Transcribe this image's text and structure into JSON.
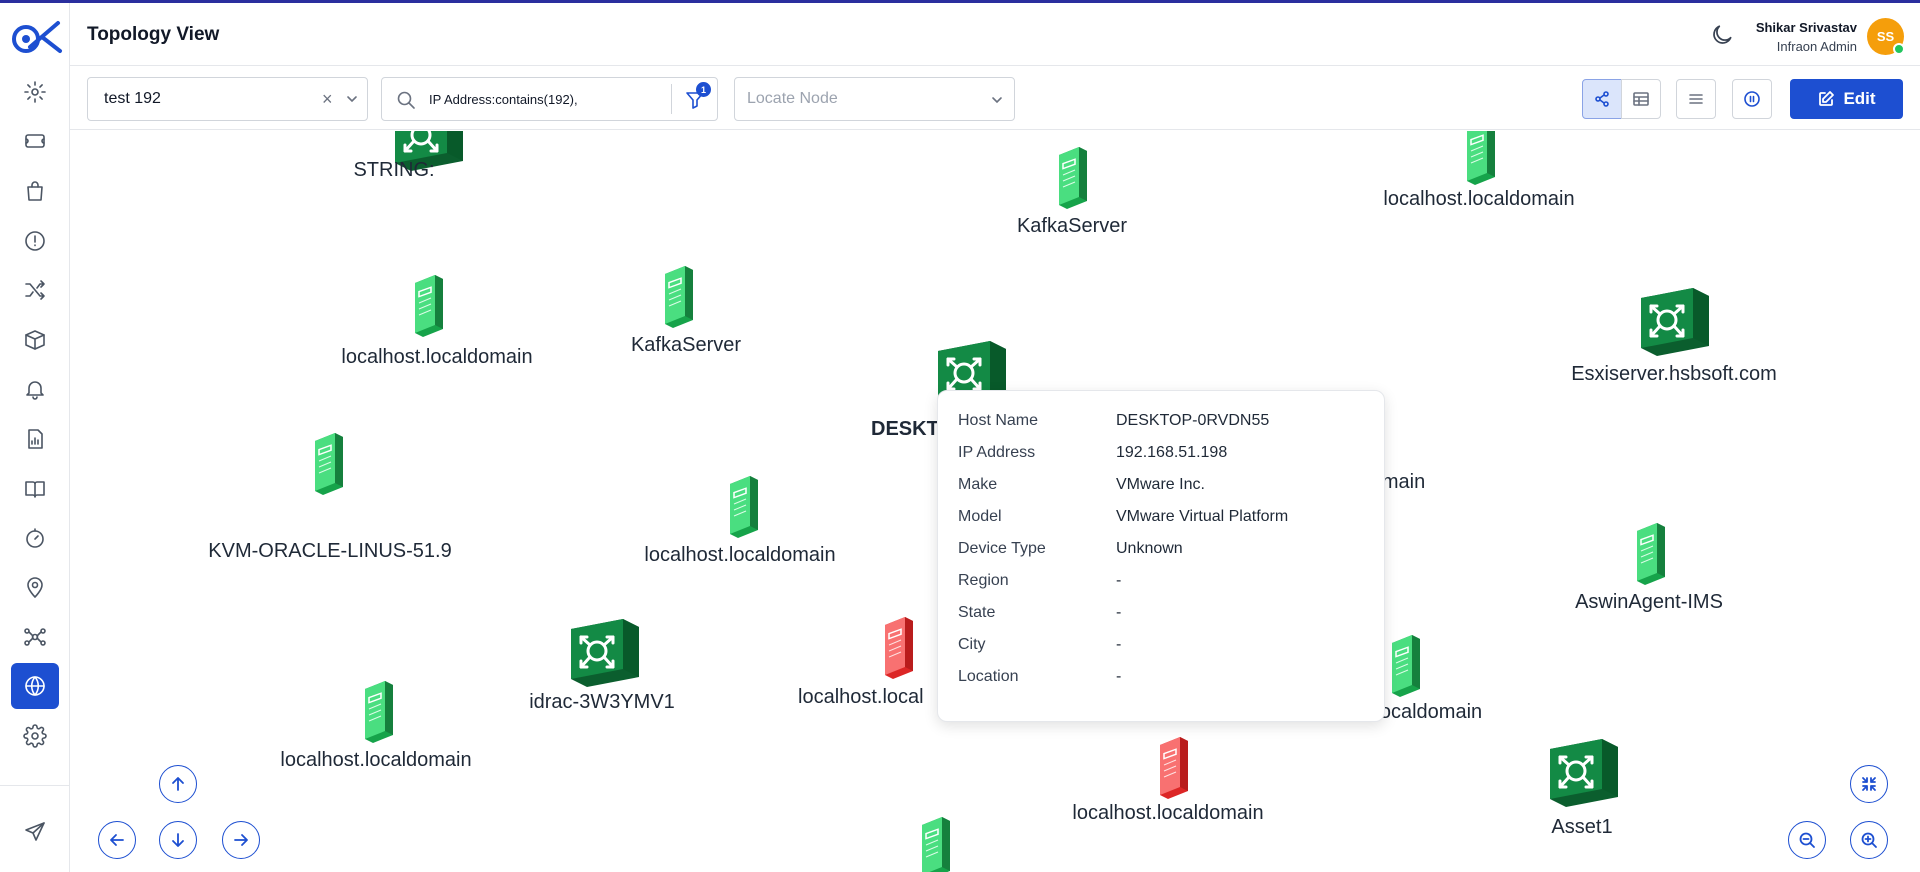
{
  "header": {
    "title": "Topology View",
    "user_name": "Shikar Srivastav",
    "user_role": "Infraon Admin",
    "avatar_initials": "SS"
  },
  "toolbar": {
    "selected_view": "test 192",
    "search_value": "IP Address:contains(192),",
    "filter_count": "1",
    "locate_placeholder": "Locate Node",
    "edit_label": "Edit"
  },
  "colors": {
    "accent": "#1d4fd1",
    "server_up": "#22c55e",
    "server_down": "#ef4444",
    "switch": "#0f7a3c",
    "avatar": "#f59e0b"
  },
  "sidebar": {
    "items": [
      {
        "icon": "settings-cog-icon",
        "active": false
      },
      {
        "icon": "ticket-icon",
        "active": false
      },
      {
        "icon": "bag-icon",
        "active": false
      },
      {
        "icon": "alert-circle-icon",
        "active": false
      },
      {
        "icon": "shuffle-icon",
        "active": false
      },
      {
        "icon": "box-icon",
        "active": false
      },
      {
        "icon": "bell-icon",
        "active": false
      },
      {
        "icon": "report-icon",
        "active": false
      },
      {
        "icon": "book-icon",
        "active": false
      },
      {
        "icon": "timer-icon",
        "active": false
      },
      {
        "icon": "location-pin-icon",
        "active": false
      },
      {
        "icon": "network-icon",
        "active": false
      },
      {
        "icon": "globe-icon",
        "active": true
      },
      {
        "icon": "gear-icon",
        "active": false
      },
      {
        "icon": "send-icon",
        "active": false
      }
    ]
  },
  "nodes": [
    {
      "label": "STRING:",
      "type": "switch",
      "status": "up"
    },
    {
      "label": "KafkaServer",
      "type": "server",
      "status": "up"
    },
    {
      "label": "localhost.localdomain",
      "type": "server",
      "status": "up"
    },
    {
      "label": "localhost.localdomain",
      "type": "server",
      "status": "up"
    },
    {
      "label": "KafkaServer",
      "type": "server",
      "status": "up"
    },
    {
      "label": "Esxiserver.hsbsoft.com",
      "type": "switch",
      "status": "up"
    },
    {
      "label": "DESKT",
      "type": "switch",
      "status": "up"
    },
    {
      "label": "omain",
      "type": "server",
      "status": "up"
    },
    {
      "label": "KVM-ORACLE-LINUS-51.9",
      "type": "server",
      "status": "up"
    },
    {
      "label": "localhost.localdomain",
      "type": "server",
      "status": "up"
    },
    {
      "label": "AswinAgent-IMS",
      "type": "server",
      "status": "up"
    },
    {
      "label": "idrac-3W3YMV1",
      "type": "switch",
      "status": "up"
    },
    {
      "label": "localhost.local",
      "type": "server",
      "status": "down"
    },
    {
      "label": "ocaldomain",
      "type": "server",
      "status": "up"
    },
    {
      "label": "localhost.localdomain",
      "type": "server",
      "status": "up"
    },
    {
      "label": "localhost.localdomain",
      "type": "server",
      "status": "down"
    },
    {
      "label": "Asset1",
      "type": "switch",
      "status": "up"
    },
    {
      "label": "",
      "type": "server",
      "status": "up"
    }
  ],
  "tooltip": {
    "rows": [
      {
        "key": "Host Name",
        "value": "DESKTOP-0RVDN55"
      },
      {
        "key": "IP Address",
        "value": "192.168.51.198"
      },
      {
        "key": "Make",
        "value": "VMware Inc."
      },
      {
        "key": "Model",
        "value": "VMware Virtual Platform"
      },
      {
        "key": "Device Type",
        "value": "Unknown"
      },
      {
        "key": "Region",
        "value": "-"
      },
      {
        "key": "State",
        "value": "-"
      },
      {
        "key": "City",
        "value": "-"
      },
      {
        "key": "Location",
        "value": "-"
      }
    ]
  }
}
